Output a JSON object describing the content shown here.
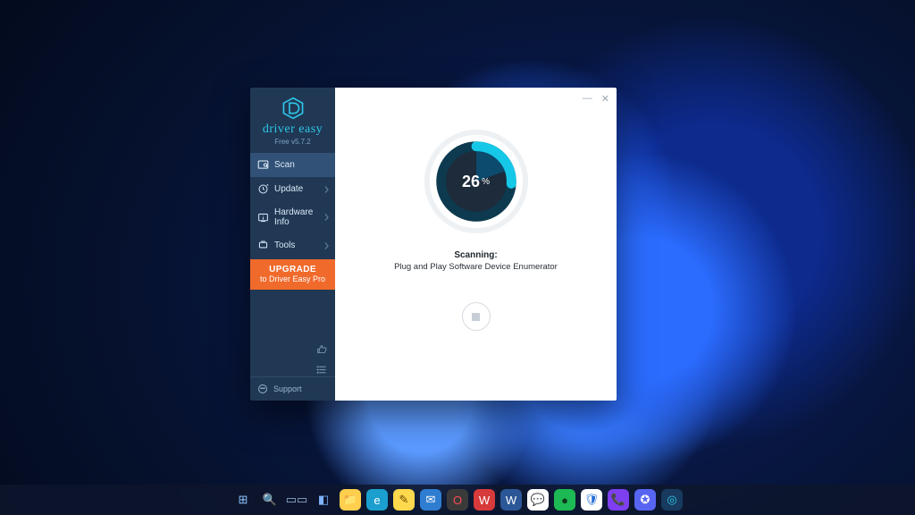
{
  "app": {
    "brand_name": "driver easy",
    "version": "Free v5.7.2",
    "nav": {
      "scan": {
        "label": "Scan"
      },
      "update": {
        "label": "Update"
      },
      "hardware_info": {
        "label": "Hardware Info"
      },
      "tools": {
        "label": "Tools"
      }
    },
    "upgrade": {
      "line1": "UPGRADE",
      "line2": "to Driver Easy Pro"
    },
    "support_label": "Support",
    "progress": {
      "percent": 26,
      "symbol": "%"
    },
    "status_heading": "Scanning:",
    "status_detail": "Plug and Play Software Device Enumerator"
  },
  "window_controls": {
    "minimize": "—",
    "close": "✕"
  },
  "taskbar": [
    {
      "name": "start",
      "bg": "transparent",
      "glyph": "⊞",
      "color": "#8ec3ff"
    },
    {
      "name": "search",
      "bg": "transparent",
      "glyph": "🔍",
      "color": "#d6e4f5"
    },
    {
      "name": "task-view",
      "bg": "transparent",
      "glyph": "▭▭",
      "color": "#9cb8dc"
    },
    {
      "name": "widgets",
      "bg": "transparent",
      "glyph": "◧",
      "color": "#7fb5ff"
    },
    {
      "name": "file-explorer",
      "bg": "#ffcf4d",
      "glyph": "📁",
      "color": "#5b3b00"
    },
    {
      "name": "edge",
      "bg": "#1a9fce",
      "glyph": "e",
      "color": "#ffffff"
    },
    {
      "name": "sticky-notes",
      "bg": "#ffd94d",
      "glyph": "✎",
      "color": "#6b4a00"
    },
    {
      "name": "mail",
      "bg": "#2f7dd1",
      "glyph": "✉",
      "color": "#ffffff"
    },
    {
      "name": "opera",
      "bg": "#3a3a3a",
      "glyph": "O",
      "color": "#ff4b55"
    },
    {
      "name": "wps",
      "bg": "#d63a3a",
      "glyph": "W",
      "color": "#ffffff"
    },
    {
      "name": "word",
      "bg": "#2b5797",
      "glyph": "W",
      "color": "#ffffff"
    },
    {
      "name": "messenger",
      "bg": "#ffffff",
      "glyph": "💬",
      "color": "#2d7bff"
    },
    {
      "name": "spotify",
      "bg": "#1db954",
      "glyph": "●",
      "color": "#0d3a1b"
    },
    {
      "name": "security",
      "bg": "#ffffff",
      "glyph": "🛡",
      "color": "#1e6bd6"
    },
    {
      "name": "viber",
      "bg": "#7d3ff0",
      "glyph": "📞",
      "color": "#ffffff"
    },
    {
      "name": "discord",
      "bg": "#5865f2",
      "glyph": "✪",
      "color": "#ffffff"
    },
    {
      "name": "driver-easy",
      "bg": "#173a5e",
      "glyph": "◎",
      "color": "#2ec7ea"
    }
  ]
}
